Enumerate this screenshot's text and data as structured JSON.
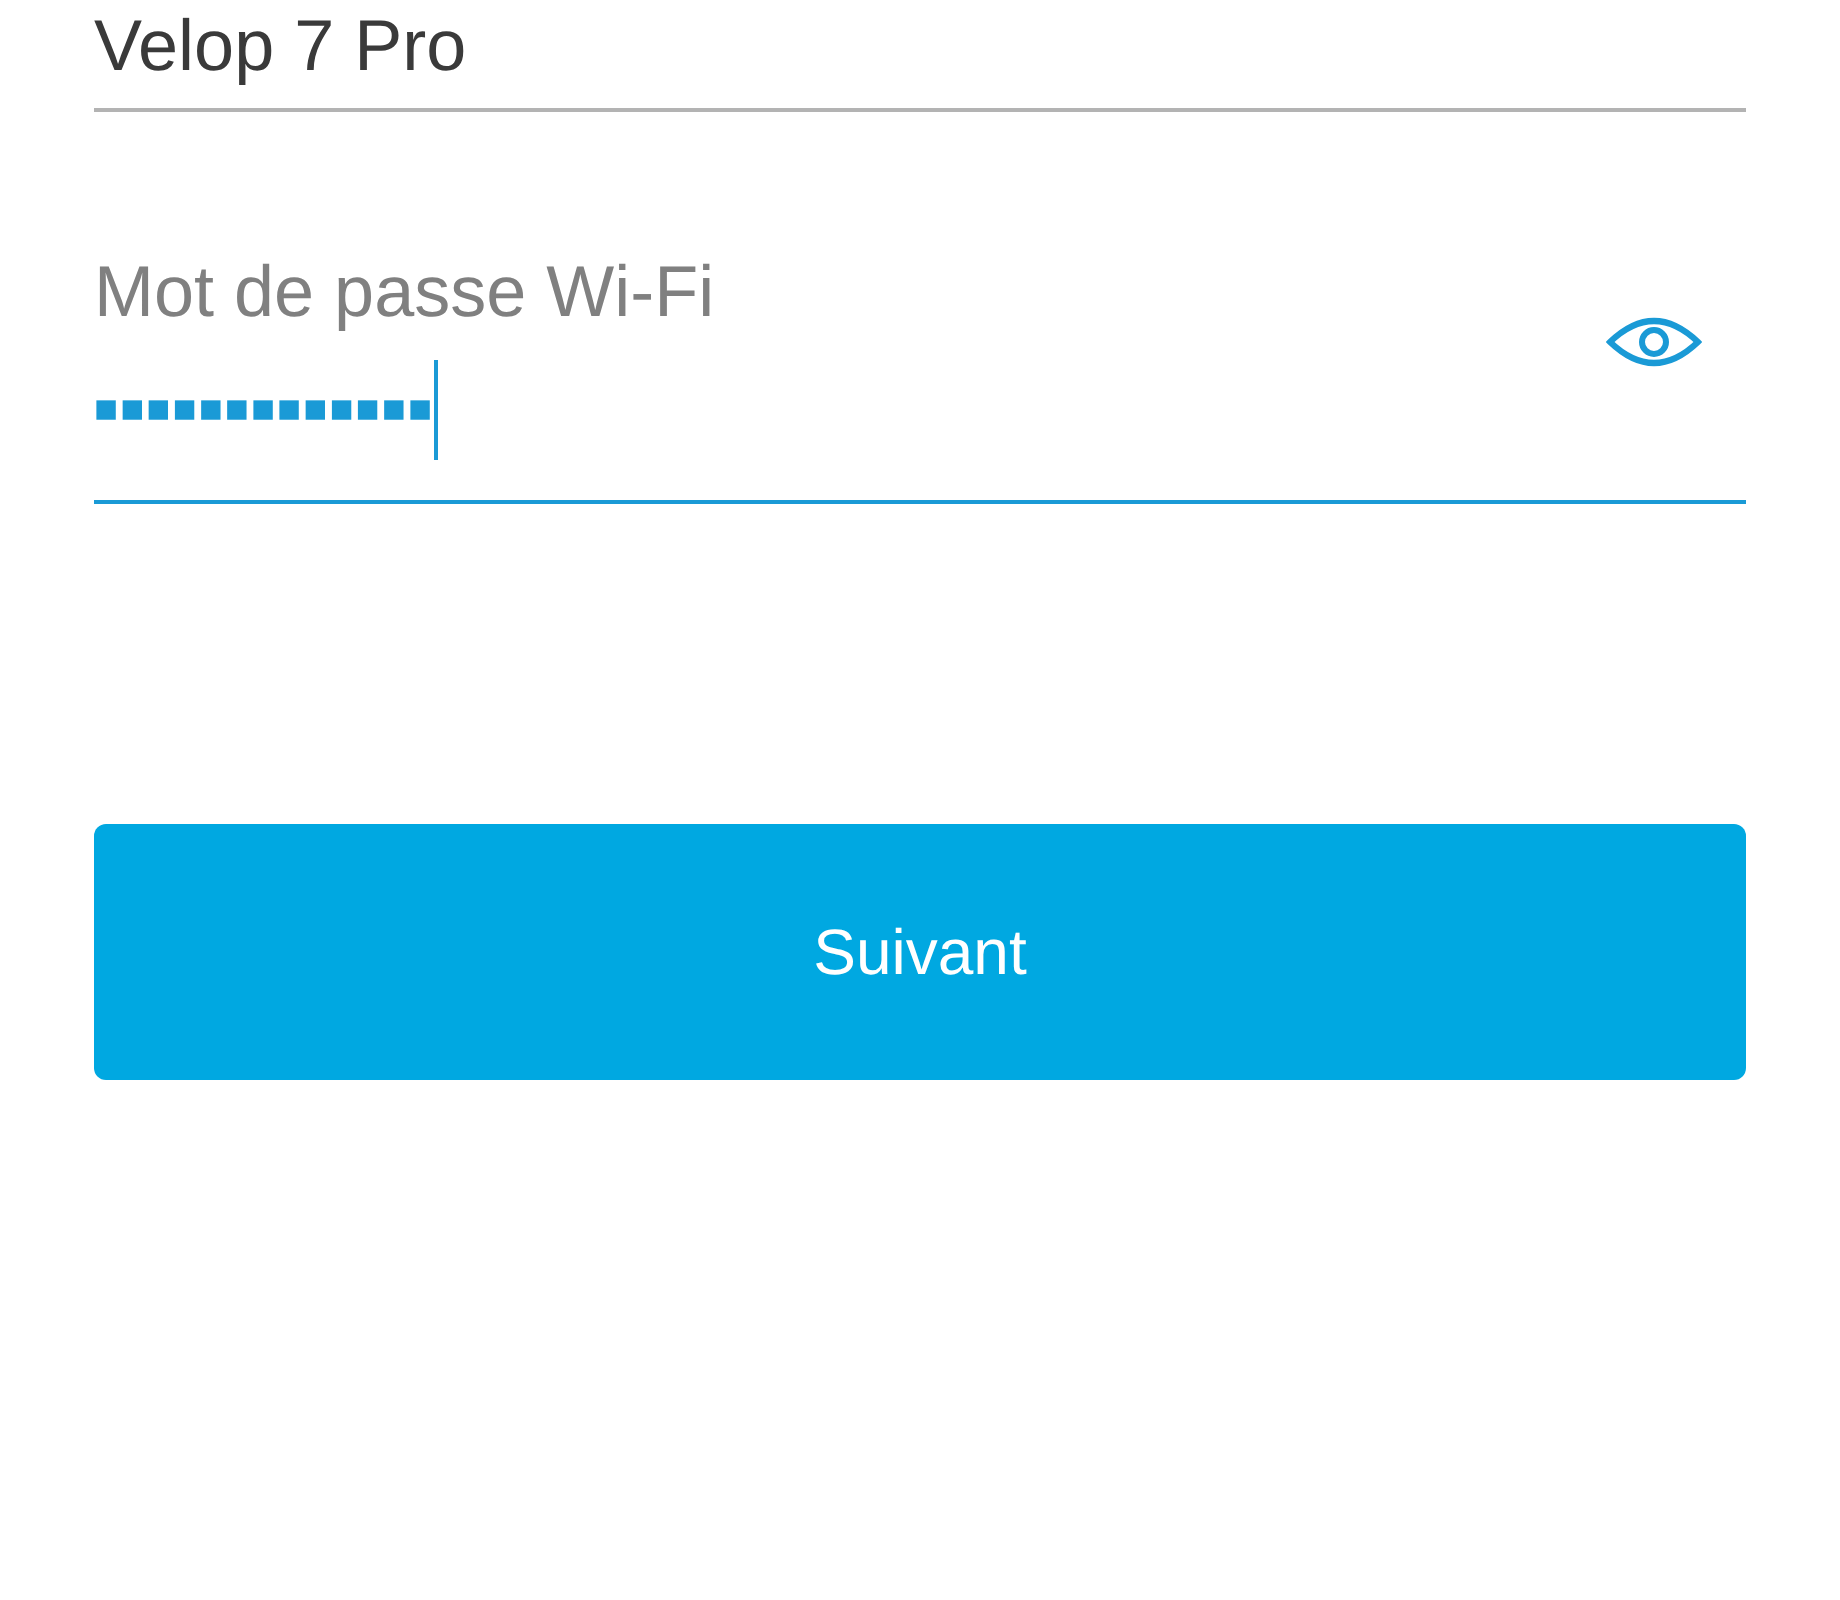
{
  "network_name_field": {
    "value": "Velop 7 Pro"
  },
  "password_field": {
    "label": "Mot de passe Wi-Fi",
    "value": "■■■■■■■■■■■■■",
    "focused": true
  },
  "next_button": {
    "label": "Suivant"
  }
}
